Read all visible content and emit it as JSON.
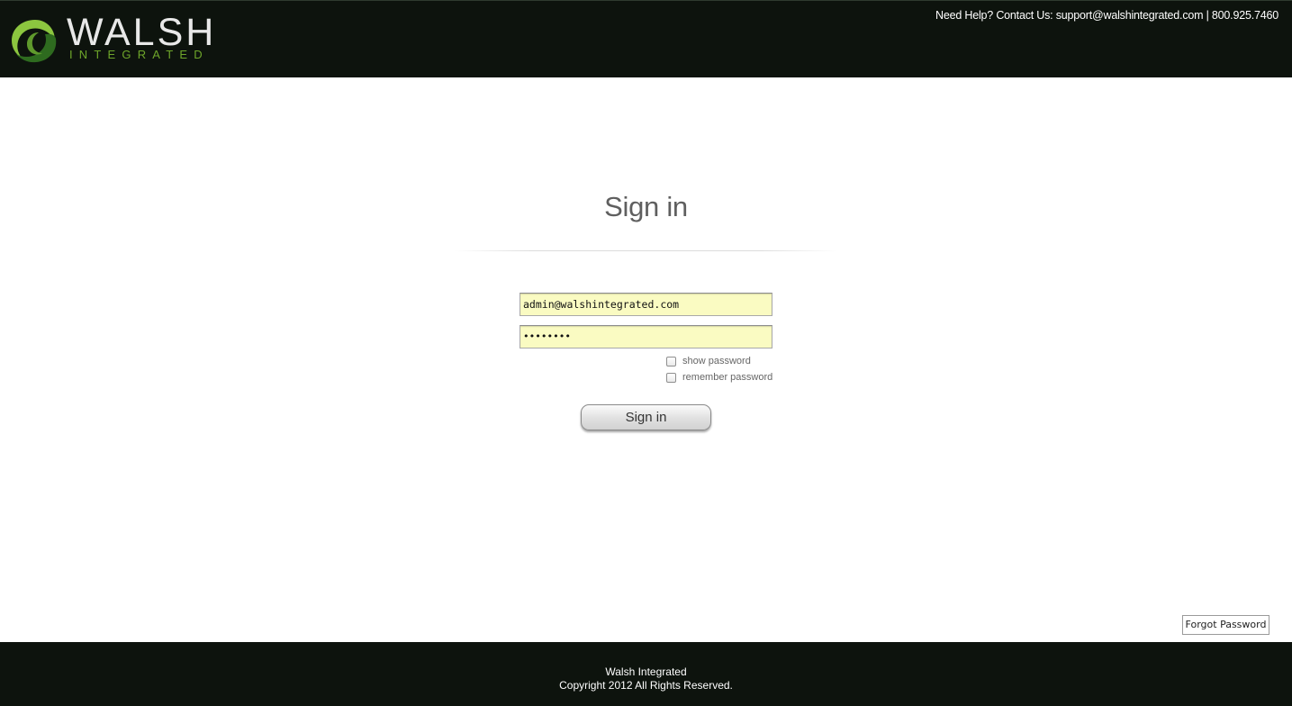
{
  "header": {
    "logo": {
      "word": "WALSH",
      "sub": "INTEGRATED",
      "icon": "walsh-swirl-logo",
      "colors": {
        "word": "#e8e8e8",
        "sub": "#6ea62a",
        "swirl_dark": "#2e6b1f",
        "swirl_light": "#8cc63f"
      }
    },
    "contact": "Need Help? Contact Us: support@walshintegrated.com | 800.925.7460",
    "background": "#0d130d"
  },
  "form": {
    "title": "Sign in",
    "email_value": "admin@walshintegrated.com",
    "password_value": "••••••••",
    "show_password_label": "show password",
    "remember_password_label": "remember password",
    "submit_label": "Sign in",
    "field_background": "#fafbc2"
  },
  "forgot_password_label": "Forgot Password",
  "footer": {
    "line1": "Walsh Integrated",
    "line2": "Copyright 2012 All Rights Reserved."
  }
}
